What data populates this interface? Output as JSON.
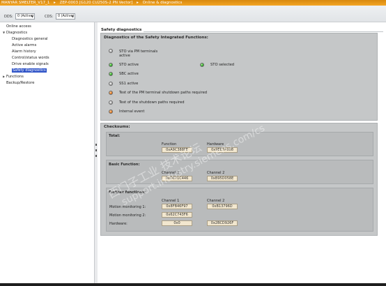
{
  "titlebar": {
    "segments": [
      "MANYAR SMELTER_V17_1",
      "▸",
      "ZEP-0003 [G120 CU250S-2 PN Vector]",
      "▸",
      "Online & diagnostics"
    ]
  },
  "toolbar": {
    "dds_label": "DDS:",
    "dds_value": "0 (Active)",
    "cds_label": "CDS:",
    "cds_value": "0 (Active)"
  },
  "tree": {
    "items": [
      {
        "label": "Online access",
        "level": 0,
        "toggle": ""
      },
      {
        "label": "Diagnostics",
        "level": 0,
        "toggle": "▼"
      },
      {
        "label": "Diagnostics general",
        "level": 1,
        "toggle": ""
      },
      {
        "label": "Active alarms",
        "level": 1,
        "toggle": ""
      },
      {
        "label": "Alarm history",
        "level": 1,
        "toggle": ""
      },
      {
        "label": "Control/status words",
        "level": 1,
        "toggle": ""
      },
      {
        "label": "Drive enable signals",
        "level": 1,
        "toggle": ""
      },
      {
        "label": "Safety diagnostics",
        "level": 1,
        "toggle": "",
        "selected": true
      },
      {
        "label": "Functions",
        "level": 0,
        "toggle": "▶"
      },
      {
        "label": "Backup/Restore",
        "level": 0,
        "toggle": ""
      }
    ]
  },
  "page": {
    "title": "Safety diagnostics",
    "sif_title": "Diagnostics of the Safety Integrated Functions:",
    "indicators": [
      {
        "label": "STO via PM terminals active",
        "state": "gray"
      },
      {
        "label": "STO active",
        "state": "green"
      },
      {
        "label": "SBC active",
        "state": "green"
      },
      {
        "label": "SS1 active",
        "state": "gray"
      },
      {
        "label": "Test of the PM terminal shutdown paths required",
        "state": "orange"
      },
      {
        "label": "Test of the shutdown paths required",
        "state": "gray"
      },
      {
        "label": "Internal event",
        "state": "orange"
      }
    ],
    "sto_selected": {
      "label": "STO selected",
      "state": "green"
    },
    "checksums": {
      "title": "Checksums:",
      "total": {
        "title": "Total:",
        "function_label": "Function",
        "hardware_label": "Hardware",
        "function_value": "0xA9C388FE",
        "hardware_value": "0x9EE7A908"
      },
      "basic": {
        "title": "Basic Function:",
        "ch1_label": "Channel 1",
        "ch2_label": "Channel 2",
        "ch1_value": "0xD671C446",
        "ch2_value": "0xB95D058E"
      },
      "further": {
        "title": "Further functions:",
        "ch1_label": "Channel 1",
        "ch2_label": "Channel 2",
        "rows": [
          {
            "label": "Motion monitoring 1:",
            "ch1": "0x8FB46F97",
            "ch2": "0xB13796D"
          },
          {
            "label": "Motion monitoring 2:",
            "ch1": "0x62C743F6",
            "ch2": ""
          },
          {
            "label": "Hardware:",
            "ch1": "0x0",
            "ch2": "0x2BCD926F"
          }
        ]
      }
    }
  },
  "watermark": {
    "cn": "西门子工业  技术论坛",
    "url": "support.industry.siemens.com/cs"
  },
  "colors": {
    "titlebar": "#f3a524",
    "selection": "#2d52c7",
    "panel": "#c5c7c8",
    "value_box": "#f2e7cf"
  }
}
